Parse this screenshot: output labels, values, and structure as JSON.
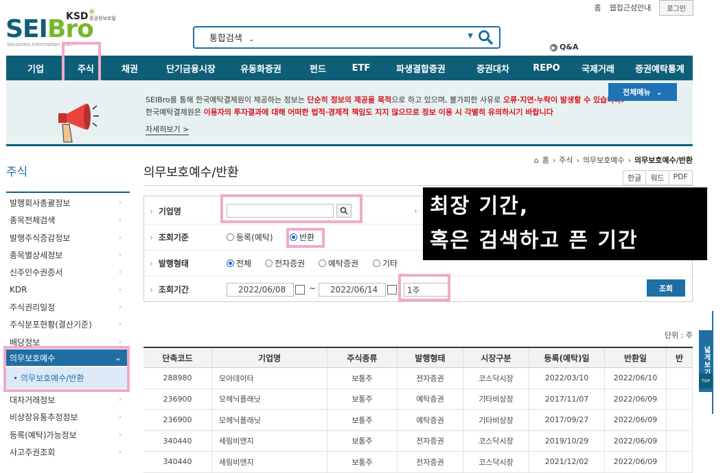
{
  "util": {
    "home": "홈",
    "accessibility": "웹접근성안내",
    "login": "로그인"
  },
  "logo": {
    "brand": "SEIBro",
    "ksd": "KSD",
    "ksd_sub": "증권정보포털",
    "subtitle": "Securities Information Bro..."
  },
  "search": {
    "scope": "통합검색",
    "placeholder": ""
  },
  "qa": "Q&A",
  "nav": [
    "기업",
    "주식",
    "채권",
    "단기금융시장",
    "유동화증권",
    "펀드",
    "ETF",
    "파생결합증권",
    "증권대차",
    "REPO",
    "국제거래",
    "증권예탁통계"
  ],
  "banner": {
    "line1_a": "SEIBro를 통해 한국예탁결제원이 제공하는 정보는 ",
    "line1_red1": "단순히 정보의 제공을 목적",
    "line1_b": "으로 하고 있으며, 불가피한 사유로 ",
    "line1_red2": "오류·지연·누락이 발생할 수 있습니다.",
    "line2_a": "한국예탁결제원은 ",
    "line2_red": "이용자의 투자결과에 대해 어떠한 법적·경제적 책임도 지지 않으므로 정보 이용 시 각별히 유의하시기 바랍니다",
    "more": "자세히보기  >",
    "all_menu": "전체메뉴"
  },
  "sidebar": {
    "title": "주식",
    "items_top": [
      "발행회사총괄정보",
      "종목전체검색",
      "발행주식증감정보",
      "종목별상세정보",
      "신주인수권증서",
      "KDR",
      "주식권리일정",
      "주식분포현황(결산기준)",
      "배당정보"
    ],
    "active": "의무보호예수",
    "active_sub": "의무보호예수/반환",
    "items_bottom": [
      "대차거래정보",
      "비상장유통추정정보",
      "등록(예탁)가능정보",
      "사고주권조회"
    ]
  },
  "breadcrumb": {
    "home": "홈",
    "l1": "주식",
    "l2": "의무보호예수",
    "current": "의무보호예수/반환"
  },
  "page_title": "의무보호예수/반환",
  "doc_buttons": [
    "한글",
    "워드",
    "PDF"
  ],
  "form": {
    "company_label": "기업명",
    "company_value": "",
    "basis_label": "조회기준",
    "basis_options": [
      "등록(예탁)",
      "반환"
    ],
    "basis_selected": "반환",
    "issue_label": "발행형태",
    "issue_options": [
      "전체",
      "전자증권",
      "예탁증권",
      "기타"
    ],
    "issue_selected": "전체",
    "period_label": "조회기간",
    "date_from": "2022/06/08",
    "date_to": "2022/06/14",
    "date_sep": "~",
    "period_select": "1주",
    "search_button": "조회"
  },
  "overlay": {
    "line1": "최장 기간,",
    "line2": "혹은 검색하고 픈 기간"
  },
  "unit": "단위 : 주",
  "table": {
    "headers": [
      "단축코드",
      "기업명",
      "주식종류",
      "발행형태",
      "시장구분",
      "등록(예탁)일",
      "반환일",
      "반"
    ],
    "rows": [
      [
        "288980",
        "모아데이타",
        "보통주",
        "전자증권",
        "코스닥시장",
        "2022/03/10",
        "2022/06/10",
        ""
      ],
      [
        "236900",
        "모헤닉플래닛",
        "보통주",
        "예탁증권",
        "기타비상장",
        "2017/11/07",
        "2022/06/09",
        ""
      ],
      [
        "236900",
        "모헤닉플래닛",
        "보통주",
        "예탁증권",
        "기타비상장",
        "2017/09/27",
        "2022/06/09",
        ""
      ],
      [
        "340440",
        "세림비앤지",
        "보통주",
        "전자증권",
        "코스닥시장",
        "2019/10/29",
        "2022/06/09",
        ""
      ],
      [
        "340440",
        "세림비앤지",
        "보통주",
        "전자증권",
        "코스닥시장",
        "2021/12/02",
        "2022/06/09",
        ""
      ]
    ]
  },
  "wide_tab": "넓게보기",
  "top_tab": "TOP",
  "colors": {
    "nav": "#0f5e78",
    "accent": "#1f6fa5",
    "highlight": "#f2a9c9",
    "warning": "#d8141b"
  }
}
